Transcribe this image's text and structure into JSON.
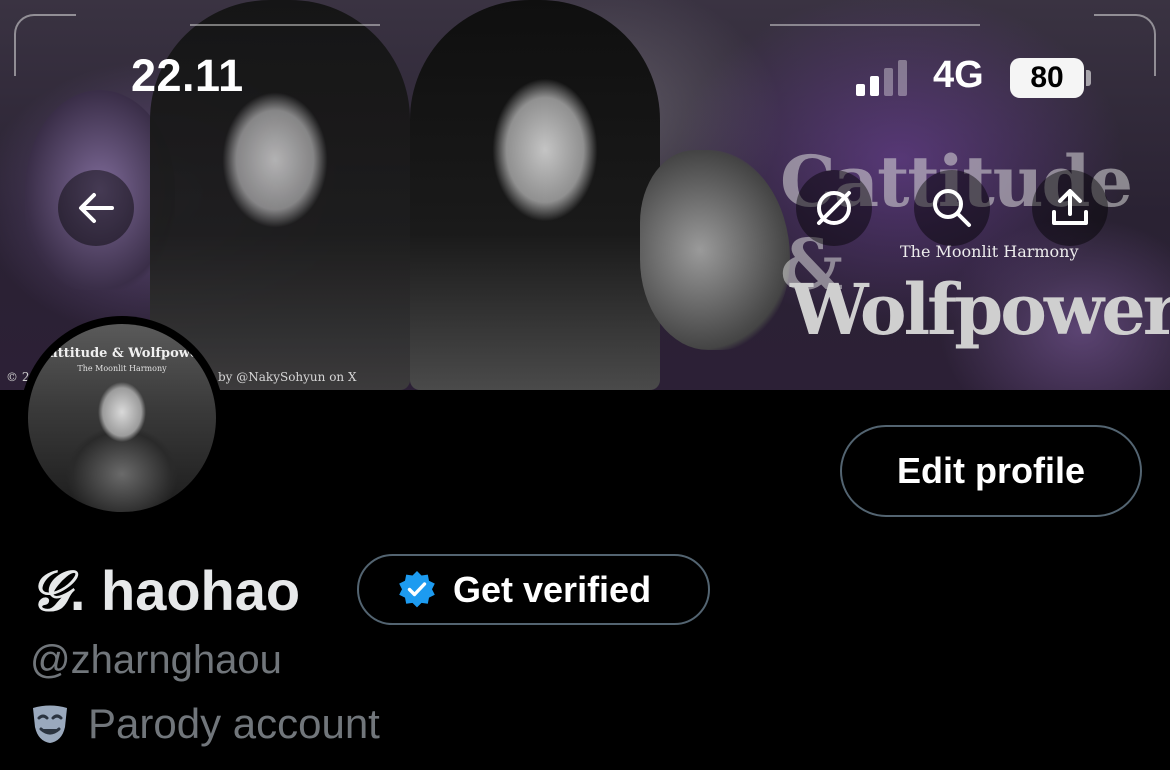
{
  "status_bar": {
    "time": "22.11",
    "network": "4G",
    "battery": "80"
  },
  "banner": {
    "logo_top": "Cattitude &",
    "logo_subtitle": "The Moonlit Harmony",
    "logo_bottom": "Wolfpower",
    "credit_left": "© 2",
    "credit_right": "by @NakySohyun on X"
  },
  "nav": {
    "back_icon": "arrow-left-icon",
    "grok_icon": "grok-icon",
    "search_icon": "search-icon",
    "share_icon": "share-icon"
  },
  "avatar": {
    "title": "Cattitude & Wolfpower",
    "subtitle": "The Moonlit Harmony"
  },
  "profile": {
    "display_name_glyph": "𝒢",
    "display_name_rest": ". haohao",
    "handle": "@zharnghaou",
    "edit_profile_label": "Edit profile",
    "get_verified_label": "Get verified",
    "parody_label": "Parody account"
  },
  "colors": {
    "background": "#000000",
    "verified_blue": "#1d9bf0",
    "muted_text": "#71767b",
    "button_border": "#536471"
  }
}
